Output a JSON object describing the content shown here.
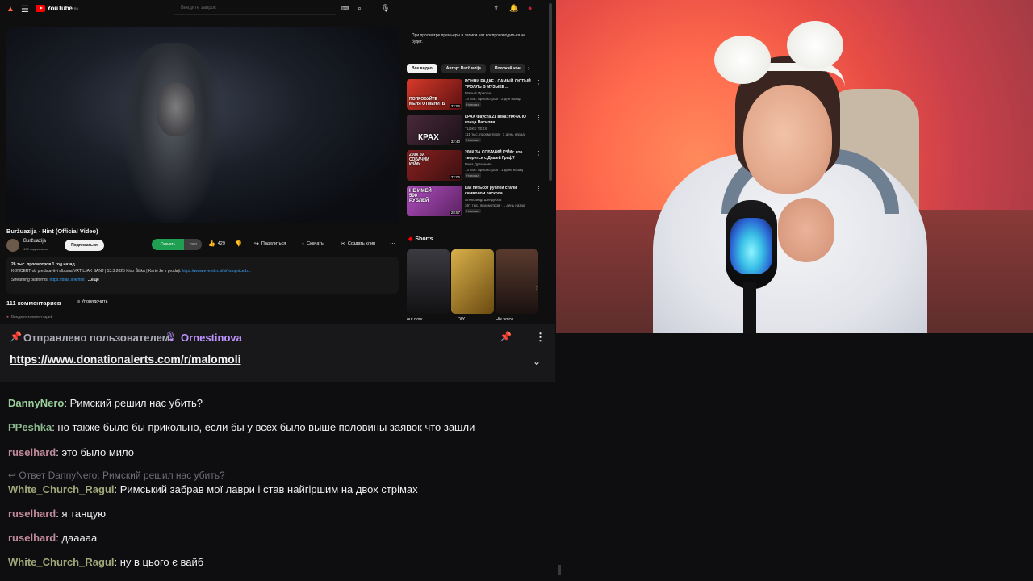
{
  "youtube": {
    "logo_text": "YouTube",
    "logo_region": "RU",
    "search_placeholder": "Введите запрос",
    "video_title": "Buržuazija - Hint (Official Video)",
    "channel_name": "Buržuazija",
    "channel_subs": "493 подписчиков",
    "subscribe_label": "Подписаться",
    "download_green_label": "Скачать",
    "download_gray_label": "1080",
    "likes": "429",
    "share_label": "Поделиться",
    "download_label": "Скачать",
    "clip_label": "Создать клип",
    "desc_stats": "26 тыс. просмотров  1 год назад",
    "desc_line1": "KONCERT ob predstavitvi albuma VRTILJAK SANJ | 13.3.2025 Kino Šiška | Karte že v prodaji: ",
    "desc_line1_link": "https://www.eventim.si/si/vstopnice/b...",
    "desc_line2": "Streaming platforms: ",
    "desc_line2_link": "https://bfan.link/hint",
    "desc_more": "...ещё",
    "comments_count": "111 комментариев",
    "sort_label": "Упорядочить",
    "add_comment_placeholder": "Введите комментарий",
    "notice": "При просмотре премьеры в записи чат воспроизводиться не будет.",
    "chips": [
      "Все видео",
      "Автор: Buržuazija",
      "Похожий кон"
    ],
    "recs": [
      {
        "title": "РОННИ РАДКЕ - САМЫЙ ЛЮТЫЙ ТРОЛЛЬ В МУЗЫКЕ ...",
        "channel": "Малый Ирискин",
        "meta": "14 тыс. просмотров · 2 дня назад",
        "badge": "Новинка",
        "duration": "32:55",
        "thumb_text": "ПОПРОБУЙТЕ МЕНЯ ОТМЕНИТЬ",
        "color": "#7a1a1a"
      },
      {
        "title": "КРАХ Фауста 21 века: НАЧАЛО конца Василия ...",
        "channel": "TLDKK TEXX",
        "meta": "111 тыс. просмотров · 1 день назад",
        "badge": "Новинка",
        "duration": "32:40",
        "thumb_text": "КРАХ",
        "color": "#3a2030"
      },
      {
        "title": "200К ЗА СОБАЧИЙ К*ЙФ: что творится с Дашей Граф?",
        "channel": "Рина Драгонова",
        "meta": "73 тыс. просмотров · 1 день назад",
        "badge": "Новинка",
        "duration": "32:06",
        "thumb_text": "200К ЗА СОБАЧИЙ К*ЙФ",
        "color": "#6a1818"
      },
      {
        "title": "Как пятьсот рублей стали символом раскола ...",
        "channel": "Александр Шендеров",
        "meta": "367 тыс. просмотров · 1 день назад",
        "badge": "Новинка",
        "duration": "28:57",
        "thumb_text": "НЕ ИМЕЙ 500 РУБЛЕЙ",
        "color": "#8a3a9a"
      }
    ],
    "shorts_title": "Shorts",
    "shorts": [
      {
        "label": "out now",
        "color": "#2a2a2e"
      },
      {
        "label": "DIY",
        "color": "#b08a2a"
      },
      {
        "label": "His voice",
        "color": "#4a3028"
      }
    ]
  },
  "chat": {
    "pinned_by_label": "Отправлено пользователем",
    "pinned_user": "Ornestinova",
    "pinned_message": "https://www.donationalerts.com/r/malomoli",
    "messages": [
      {
        "user": "DannyNero",
        "color": "#9acd9a",
        "text": ": Римский решил нас убить?"
      },
      {
        "user": "PPeshka",
        "color": "#8fbc8f",
        "text": ": но также было бы прикольно, если бы у всех было выше половины заявок что зашли"
      },
      {
        "user": "ruselhard",
        "color": "#c08a9a",
        "text": ": это было мило"
      },
      {
        "reply_to": "Ответ DannyNero: Римский решил нас убить?",
        "user": "White_Church_Ragul",
        "color": "#a0a87a",
        "text": ": Римський забрав мої лаври і став найгіршим на двох стрімах"
      },
      {
        "user": "ruselhard",
        "color": "#c08a9a",
        "text": ": я танцую"
      },
      {
        "user": "ruselhard",
        "color": "#c08a9a",
        "text": ": дааааа"
      },
      {
        "user": "White_Church_Ragul",
        "color": "#a0a87a",
        "text": ": ну в цього є вайб"
      }
    ]
  }
}
